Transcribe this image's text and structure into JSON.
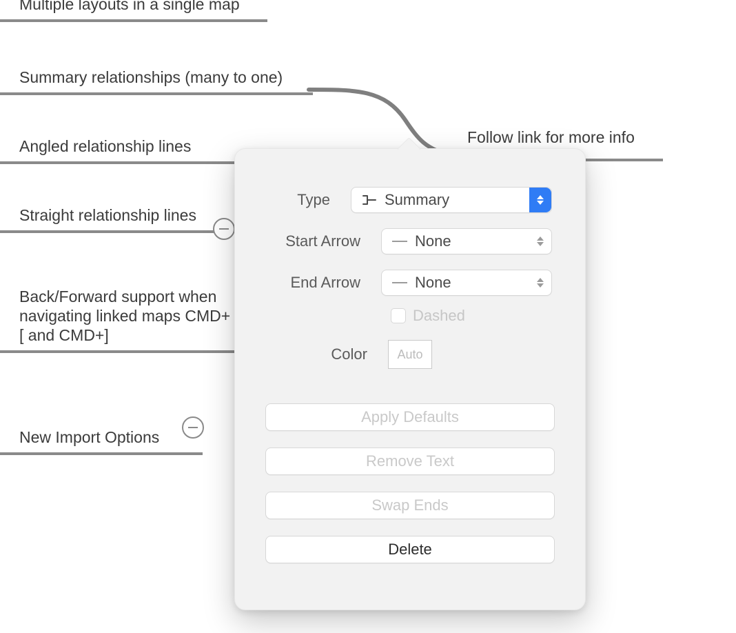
{
  "items": [
    {
      "label": "Multiple layouts in a single map"
    },
    {
      "label": "Summary relationships (many to one)"
    },
    {
      "label": "Angled relationship lines"
    },
    {
      "label": "Straight relationship lines"
    },
    {
      "label": "Back/Forward support when navigating linked maps CMD+[ and CMD+]"
    },
    {
      "label": "New Import Options"
    }
  ],
  "note": "Follow link for more info",
  "popover": {
    "rows": {
      "type": {
        "label": "Type",
        "value": "Summary"
      },
      "startArrow": {
        "label": "Start Arrow",
        "value": "None"
      },
      "endArrow": {
        "label": "End Arrow",
        "value": "None"
      },
      "dashed": {
        "label": "Dashed"
      },
      "color": {
        "label": "Color",
        "value": "Auto"
      }
    },
    "buttons": {
      "applyDefaults": "Apply Defaults",
      "removeText": "Remove Text",
      "swapEnds": "Swap Ends",
      "delete": "Delete"
    }
  }
}
